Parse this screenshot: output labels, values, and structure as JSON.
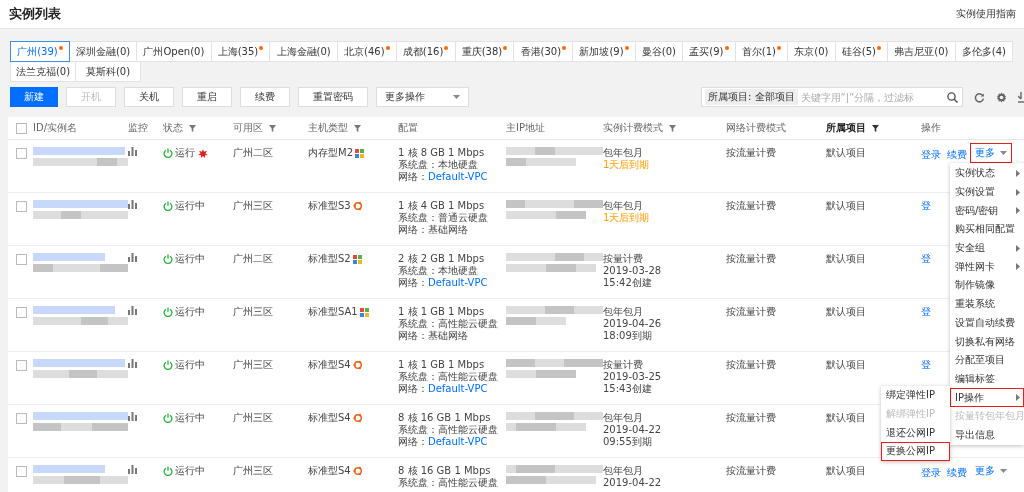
{
  "header": {
    "title": "实例列表",
    "guide_link": "实例使用指南"
  },
  "region_tabs": [
    [
      {
        "label": "广州(39)",
        "dot": true,
        "selected": true
      },
      {
        "label": "深圳金融(0)",
        "dot": false,
        "selected": false
      },
      {
        "label": "广州Open(0)",
        "dot": false,
        "selected": false
      },
      {
        "label": "上海(35)",
        "dot": true,
        "selected": false
      },
      {
        "label": "上海金融(0)",
        "dot": false,
        "selected": false
      },
      {
        "label": "北京(46)",
        "dot": true,
        "selected": false
      },
      {
        "label": "成都(16)",
        "dot": true,
        "selected": false
      },
      {
        "label": "重庆(38)",
        "dot": true,
        "selected": false
      },
      {
        "label": "香港(30)",
        "dot": true,
        "selected": false
      },
      {
        "label": "新加坡(9)",
        "dot": true,
        "selected": false
      },
      {
        "label": "曼谷(0)",
        "dot": false,
        "selected": false
      },
      {
        "label": "孟买(9)",
        "dot": true,
        "selected": false
      },
      {
        "label": "首尔(1)",
        "dot": true,
        "selected": false
      },
      {
        "label": "东京(0)",
        "dot": false,
        "selected": false
      },
      {
        "label": "硅谷(5)",
        "dot": true,
        "selected": false
      },
      {
        "label": "弗吉尼亚(0)",
        "dot": false,
        "selected": false
      },
      {
        "label": "多伦多(4)",
        "dot": false,
        "selected": false
      }
    ],
    [
      {
        "label": "法兰克福(0)",
        "dot": false,
        "selected": false
      },
      {
        "label": "莫斯科(0)",
        "dot": false,
        "selected": false
      }
    ]
  ],
  "toolbar": {
    "buttons": [
      {
        "label": "新建",
        "kind": "primary",
        "disabled": false
      },
      {
        "label": "开机",
        "kind": "normal",
        "disabled": true
      },
      {
        "label": "关机",
        "kind": "normal",
        "disabled": false
      },
      {
        "label": "重启",
        "kind": "normal",
        "disabled": false
      },
      {
        "label": "续费",
        "kind": "normal",
        "disabled": false
      },
      {
        "label": "重置密码",
        "kind": "normal",
        "disabled": false
      },
      {
        "label": "更多操作",
        "kind": "dropdown",
        "disabled": false
      }
    ],
    "project_tag": "所属项目: 全部项目",
    "search_placeholder": "关键字用“|”分隔，过滤标"
  },
  "select_all_checked": false,
  "table": {
    "columns": [
      {
        "label": "ID/实例名",
        "filter": false
      },
      {
        "label": "监控",
        "filter": false
      },
      {
        "label": "状态",
        "filter": true
      },
      {
        "label": "可用区",
        "filter": true
      },
      {
        "label": "主机类型",
        "filter": true
      },
      {
        "label": "配置",
        "filter": false
      },
      {
        "label": "主IP地址",
        "filter": false
      },
      {
        "label": "实例计费模式",
        "filter": true
      },
      {
        "label": "网络计费模式",
        "filter": false
      },
      {
        "label": "所属项目",
        "filter": true
      },
      {
        "label": "操作",
        "filter": false
      }
    ],
    "rows": [
      {
        "checked": false,
        "status": "运行",
        "marked": true,
        "zone": "广州二区",
        "type": "内存型M2",
        "kind": "windows",
        "config": [
          "1 核 8 GB 1 Mbps",
          "系统盘：本地硬盘"
        ],
        "network": {
          "label": "网络：",
          "value": "Default-VPC",
          "link": true
        },
        "billing": [
          {
            "text": "包年包月",
            "warn": false
          },
          {
            "text": "1天后到期",
            "warn": true
          }
        ],
        "net_billing": "按流量计费",
        "project": "默认项目",
        "actions": [
          {
            "label": "登录",
            "kind": "link"
          },
          {
            "label": "续费",
            "kind": "link"
          },
          {
            "label": "更多",
            "kind": "more",
            "highlighted": true
          }
        ]
      },
      {
        "checked": false,
        "status": "运行中",
        "marked": false,
        "zone": "广州三区",
        "type": "标准型S3",
        "kind": "ubuntu",
        "config": [
          "1 核 4 GB 1 Mbps",
          "系统盘：普通云硬盘"
        ],
        "network": {
          "label": "网络：",
          "value": "基础网络",
          "link": false
        },
        "billing": [
          {
            "text": "包年包月",
            "warn": false
          },
          {
            "text": "1天后到期",
            "warn": true
          }
        ],
        "net_billing": "按流量计费",
        "project": "默认项目",
        "actions": [
          {
            "label": "登",
            "kind": "link"
          }
        ]
      },
      {
        "checked": false,
        "status": "运行中",
        "marked": false,
        "zone": "广州二区",
        "type": "标准型S2",
        "kind": "windows",
        "config": [
          "2 核 2 GB 1 Mbps",
          "系统盘：本地硬盘"
        ],
        "network": {
          "label": "网络：",
          "value": "Default-VPC",
          "link": true
        },
        "billing": [
          {
            "text": "按量计费",
            "warn": false
          },
          {
            "text": "2019-03-28",
            "warn": false
          },
          {
            "text": "15:42创建",
            "warn": false
          }
        ],
        "net_billing": "按流量计费",
        "project": "默认项目",
        "actions": [
          {
            "label": "登",
            "kind": "link"
          }
        ]
      },
      {
        "checked": false,
        "status": "运行中",
        "marked": false,
        "zone": "广州三区",
        "type": "标准型SA1",
        "kind": "windows",
        "config": [
          "1 核 1 GB 1 Mbps",
          "系统盘：高性能云硬盘"
        ],
        "network": {
          "label": "网络：",
          "value": "基础网络",
          "link": false
        },
        "billing": [
          {
            "text": "包年包月",
            "warn": false
          },
          {
            "text": "2019-04-26",
            "warn": false
          },
          {
            "text": "18:09到期",
            "warn": false
          }
        ],
        "net_billing": "按流量计费",
        "project": "默认项目",
        "actions": [
          {
            "label": "登",
            "kind": "link"
          }
        ]
      },
      {
        "checked": false,
        "status": "运行中",
        "marked": false,
        "zone": "广州三区",
        "type": "标准型S4",
        "kind": "ubuntu",
        "config": [
          "1 核 1 GB 1 Mbps",
          "系统盘：高性能云硬盘"
        ],
        "network": {
          "label": "网络：",
          "value": "Default-VPC",
          "link": true
        },
        "billing": [
          {
            "text": "按量计费",
            "warn": false
          },
          {
            "text": "2019-03-25",
            "warn": false
          },
          {
            "text": "15:43创建",
            "warn": false
          }
        ],
        "net_billing": "按流量计费",
        "project": "默认项目",
        "actions": [
          {
            "label": "登",
            "kind": "link"
          }
        ]
      },
      {
        "checked": false,
        "status": "运行中",
        "marked": false,
        "zone": "广州三区",
        "type": "标准型S4",
        "kind": "ubuntu",
        "config": [
          "8 核 16 GB 1 Mbps",
          "系统盘：高性能云硬盘"
        ],
        "network": {
          "label": "网络：",
          "value": "Default-VPC",
          "link": true
        },
        "billing": [
          {
            "text": "包年包月",
            "warn": false
          },
          {
            "text": "2019-04-22",
            "warn": false
          },
          {
            "text": "09:55到期",
            "warn": false
          }
        ],
        "net_billing": "按流量计费",
        "project": "默认项目",
        "actions": []
      },
      {
        "checked": false,
        "status": "运行中",
        "marked": false,
        "zone": "广州三区",
        "type": "标准型S4",
        "kind": "ubuntu",
        "config": [
          "8 核 16 GB 1 Mbps",
          "系统盘：高性能云硬盘"
        ],
        "billing": [
          {
            "text": "包年包月",
            "warn": false
          },
          {
            "text": "2019-04-22",
            "warn": false
          }
        ],
        "net_billing": "按流量计费",
        "project": "默认项目",
        "actions": [
          {
            "label": "登录",
            "kind": "link"
          },
          {
            "label": "续费",
            "kind": "link"
          },
          {
            "label": "更多",
            "kind": "more",
            "highlighted": false
          }
        ]
      }
    ]
  },
  "more_menu": [
    {
      "label": "实例状态",
      "submenu": true,
      "disabled": false,
      "highlighted": false
    },
    {
      "label": "实例设置",
      "submenu": true,
      "disabled": false,
      "highlighted": false
    },
    {
      "label": "密码/密钥",
      "submenu": true,
      "disabled": false,
      "highlighted": false
    },
    {
      "label": "购买相同配置",
      "submenu": false,
      "disabled": false,
      "highlighted": false
    },
    {
      "label": "安全组",
      "submenu": true,
      "disabled": false,
      "highlighted": false
    },
    {
      "label": "弹性网卡",
      "submenu": true,
      "disabled": false,
      "highlighted": false
    },
    {
      "label": "制作镜像",
      "submenu": false,
      "disabled": false,
      "highlighted": false
    },
    {
      "label": "重装系统",
      "submenu": false,
      "disabled": false,
      "highlighted": false
    },
    {
      "label": "设置自动续费",
      "submenu": false,
      "disabled": false,
      "highlighted": false
    },
    {
      "label": "切换私有网络",
      "submenu": false,
      "disabled": false,
      "highlighted": false
    },
    {
      "label": "分配至项目",
      "submenu": false,
      "disabled": false,
      "highlighted": false
    },
    {
      "label": "编辑标签",
      "submenu": false,
      "disabled": false,
      "highlighted": false
    },
    {
      "label": "IP操作",
      "submenu": true,
      "disabled": false,
      "highlighted": true
    },
    {
      "label": "按量转包年包月",
      "submenu": false,
      "disabled": true,
      "highlighted": false
    },
    {
      "label": "导出信息",
      "submenu": false,
      "disabled": false,
      "highlighted": false
    }
  ],
  "ip_submenu": [
    {
      "label": "绑定弹性IP",
      "disabled": false,
      "highlighted": false
    },
    {
      "label": "解绑弹性IP",
      "disabled": true,
      "highlighted": false
    },
    {
      "label": "退还公网IP",
      "disabled": false,
      "highlighted": false
    },
    {
      "label": "更换公网IP",
      "disabled": false,
      "highlighted": true
    }
  ]
}
